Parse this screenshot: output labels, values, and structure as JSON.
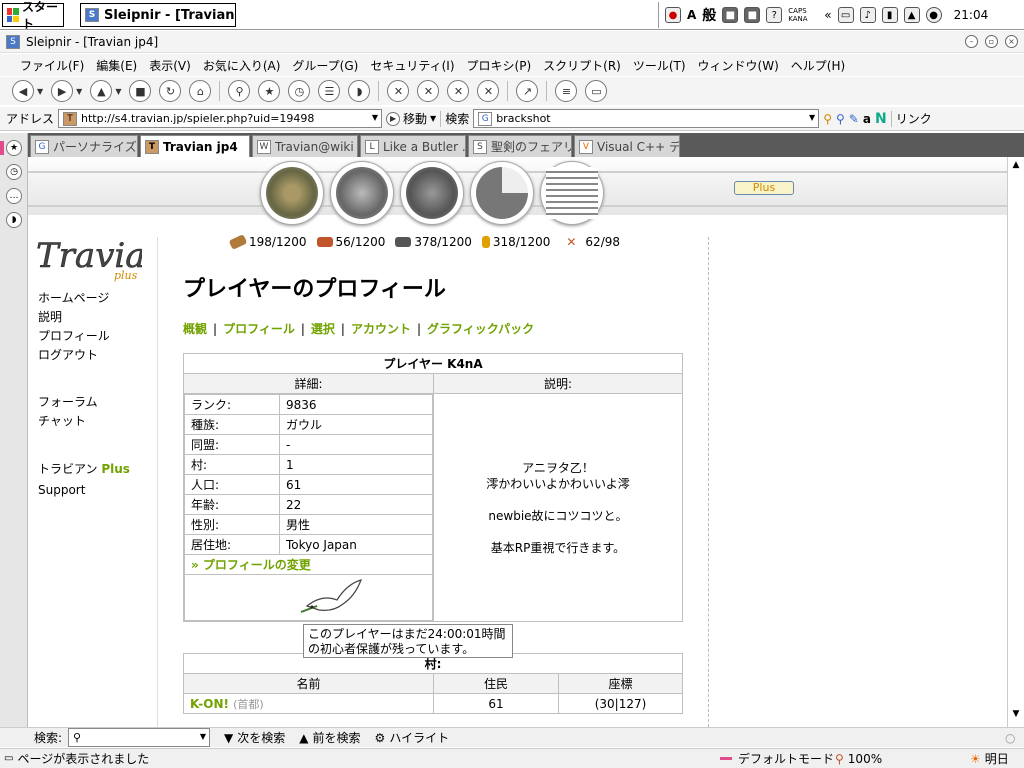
{
  "taskbar": {
    "start_label": "スタート",
    "window_button": "Sleipnir - [Travian ...",
    "tray_text": "CAPS KANA",
    "tray_kana": "般",
    "tray_a": "A",
    "tray_help": "?",
    "clock": "21:04"
  },
  "window": {
    "title": "Sleipnir - [Travian jp4]"
  },
  "menu": [
    "ファイル(F)",
    "編集(E)",
    "表示(V)",
    "お気に入り(A)",
    "グループ(G)",
    "セキュリティ(I)",
    "プロキシ(P)",
    "スクリプト(R)",
    "ツール(T)",
    "ウィンドウ(W)",
    "ヘルプ(H)"
  ],
  "address": {
    "label": "アドレス",
    "url": "http://s4.travian.jp/spieler.php?uid=19498",
    "go": "移動",
    "search_label": "検索",
    "search_value": "brackshot",
    "links": "リンク"
  },
  "tabs": [
    {
      "label": "パーソナライズド...",
      "icon": "G",
      "active": false
    },
    {
      "label": "Travian jp4",
      "icon": "T",
      "active": true
    },
    {
      "label": "Travian@wiki - ...",
      "icon": "W",
      "active": false
    },
    {
      "label": "Like a Butler ...",
      "icon": "L",
      "active": false
    },
    {
      "label": "聖剣のフェアリー...",
      "icon": "S",
      "active": false
    },
    {
      "label": "Visual C++ デ...",
      "icon": "V",
      "active": false
    }
  ],
  "site": {
    "plus_button": "Plus",
    "logo": "Travian",
    "logo_plus": "plus",
    "nav": {
      "home": "ホームページ",
      "help": "説明",
      "profile": "プロフィール",
      "logout": "ログアウト",
      "forum": "フォーラム",
      "chat": "チャット",
      "travian_plus_prefix": "トラビアン",
      "travian_plus_suffix": "Plus",
      "support": "Support"
    },
    "resources": {
      "wood": "198/1200",
      "clay": "56/1200",
      "iron": "378/1200",
      "crop": "318/1200",
      "consumption": "62/98"
    }
  },
  "profile": {
    "heading": "プレイヤーのプロフィール",
    "subnav": [
      "概観",
      "プロフィール",
      "選択",
      "アカウント",
      "グラフィックパック"
    ],
    "player_title": "プレイヤー K4nA",
    "col_details": "詳細:",
    "col_description": "説明:",
    "fields": [
      {
        "label": "ランク:",
        "value": "9836"
      },
      {
        "label": "種族:",
        "value": "ガウル"
      },
      {
        "label": "同盟:",
        "value": "-"
      },
      {
        "label": "村:",
        "value": "1"
      },
      {
        "label": "人口:",
        "value": "61"
      },
      {
        "label": "年齢:",
        "value": "22"
      },
      {
        "label": "性別:",
        "value": "男性"
      },
      {
        "label": "居住地:",
        "value": "Tokyo Japan"
      }
    ],
    "change_link": "» プロフィールの変更",
    "description_lines": [
      "アニヲタ乙！",
      "澪かわいいよかわいいよ澪",
      "",
      "newbie故にコツコツと。",
      "",
      "基本RP重視で行きます。"
    ],
    "tooltip": "このプレイヤーはまだ24:00:01時間の初心者保護が残っています。"
  },
  "villages": {
    "title": "村:",
    "headers": [
      "名前",
      "住民",
      "座標"
    ],
    "rows": [
      {
        "name": "K-ON!",
        "tag": "(首都)",
        "population": "61",
        "coords": "(30|127)"
      }
    ]
  },
  "findbar": {
    "label": "検索:",
    "next": "次を検索",
    "prev": "前を検索",
    "highlight": "ハイライト"
  },
  "status": {
    "message": "ページが表示されました",
    "mode": "デフォルトモード",
    "zoom": "100%",
    "weather": "明日"
  },
  "colors": {
    "accent_green": "#71a200",
    "plus_orange": "#d08a00"
  }
}
